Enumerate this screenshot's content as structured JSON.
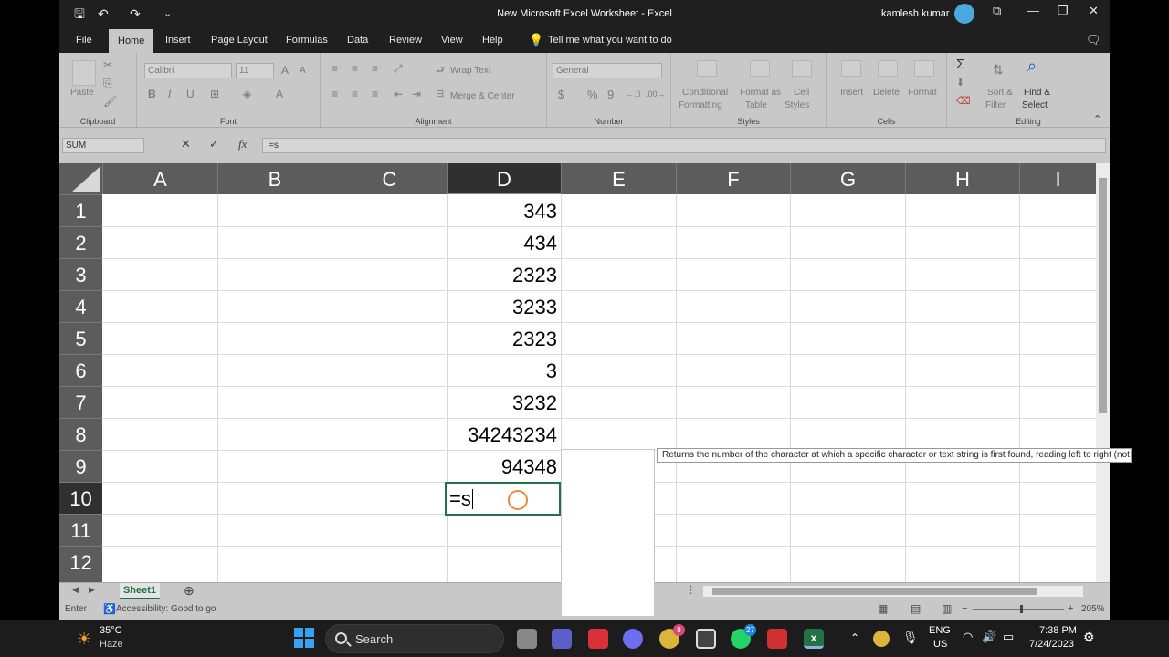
{
  "window": {
    "title": "New Microsoft Excel Worksheet  -  Excel",
    "user": "kamlesh kumar",
    "qat_more": "⌄"
  },
  "tabs": [
    "File",
    "Home",
    "Insert",
    "Page Layout",
    "Formulas",
    "Data",
    "Review",
    "View",
    "Help"
  ],
  "tell_me": "Tell me what you want to do",
  "ribbon": {
    "clipboard": {
      "label": "Clipboard",
      "paste": "Paste"
    },
    "font": {
      "label": "Font",
      "name": "Calibri",
      "size": "11",
      "grow": "A",
      "shrink": "A",
      "bold": "B",
      "italic": "I",
      "underline": "U",
      "color": "A"
    },
    "alignment": {
      "label": "Alignment",
      "wrap": "Wrap Text",
      "merge": "Merge & Center"
    },
    "number": {
      "label": "Number",
      "format": "General",
      "currency": "$",
      "percent": "%",
      "comma": "9"
    },
    "styles": {
      "label": "Styles",
      "conditional": "Conditional",
      "formatting": "Formatting",
      "format_as": "Format as",
      "table": "Table",
      "cell": "Cell",
      "styles_txt": "Styles"
    },
    "cells": {
      "label": "Cells",
      "insert": "Insert",
      "delete": "Delete",
      "format": "Format"
    },
    "editing": {
      "label": "Editing",
      "sum": "Σ",
      "sort": "Sort &",
      "filter": "Filter",
      "find": "Find &",
      "select": "Select"
    }
  },
  "formula_bar": {
    "name_box": "SUM",
    "cancel": "✕",
    "enter": "✓",
    "fx": "fx",
    "value": "=s"
  },
  "columns": [
    "A",
    "B",
    "C",
    "D",
    "E",
    "F",
    "G",
    "H",
    "I"
  ],
  "rows": [
    "1",
    "2",
    "3",
    "4",
    "5",
    "6",
    "7",
    "8",
    "9",
    "10",
    "11",
    "12"
  ],
  "column_d_values": [
    "343",
    "434",
    "2323",
    "3233",
    "2323",
    "3",
    "3232",
    "34243234",
    "94348"
  ],
  "active_cell": {
    "text": "=s"
  },
  "tooltip": "Returns the number of the character at which a specific character or text string is first found, reading left to right (not case-sensitive)",
  "sheet_tab": "Sheet1",
  "status": {
    "mode": "Enter",
    "accessibility": "Accessibility: Good to go",
    "zoom": "205%"
  },
  "taskbar": {
    "temp": "35°C",
    "weather": "Haze",
    "search": "Search",
    "lang1": "ENG",
    "lang2": "US",
    "time": "7:38 PM",
    "date": "7/24/2023",
    "badge_chrome": "8",
    "badge_whatsapp": "27"
  },
  "colors": {
    "excel_green": "#217346",
    "header_gray": "#5c5c5c",
    "selected_header": "#303030"
  }
}
